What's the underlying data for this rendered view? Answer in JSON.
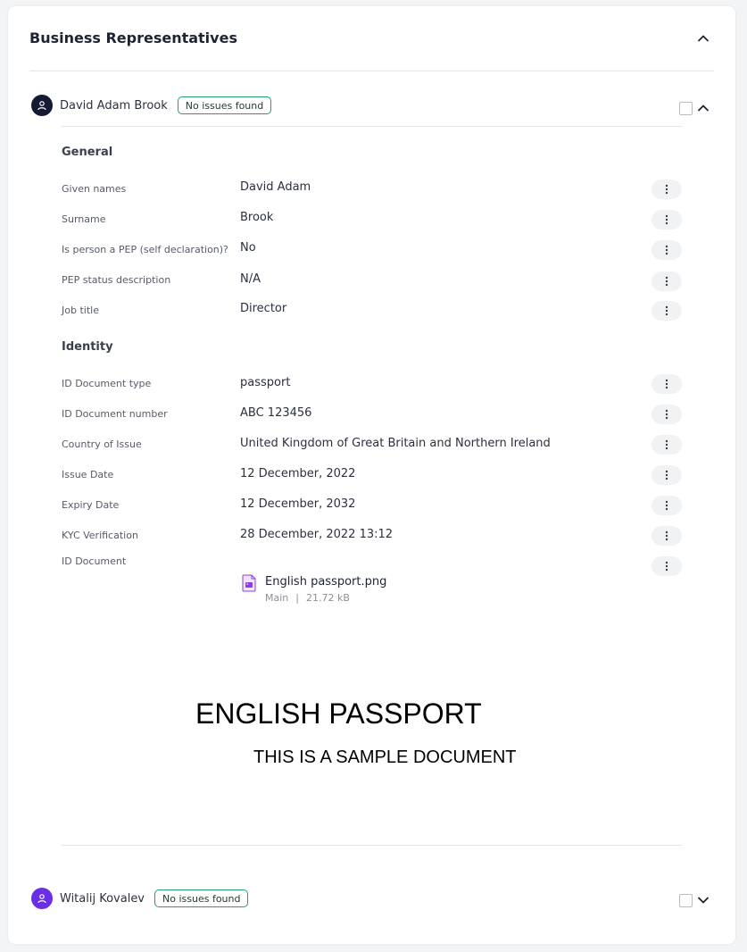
{
  "section": {
    "title": "Business Representatives"
  },
  "representatives": [
    {
      "name": "David Adam Brook",
      "badge": "No issues found",
      "avatar_color": "#141a33",
      "expanded": true
    },
    {
      "name": "Witalij Kovalev",
      "badge": "No issues found",
      "avatar_color": "#6b2ee6",
      "expanded": false
    }
  ],
  "general": {
    "title": "General",
    "fields": [
      {
        "label": "Given names",
        "value": "David Adam"
      },
      {
        "label": "Surname",
        "value": "Brook"
      },
      {
        "label": "Is person a PEP (self declaration)?",
        "value": "No"
      },
      {
        "label": "PEP status description",
        "value": "N/A"
      },
      {
        "label": "Job title",
        "value": "Director"
      }
    ]
  },
  "identity": {
    "title": "Identity",
    "fields": [
      {
        "label": "ID Document type",
        "value": "passport"
      },
      {
        "label": "ID Document number",
        "value": "ABC 123456"
      },
      {
        "label": "Country of Issue",
        "value": "United Kingdom of Great Britain and Northern Ireland"
      },
      {
        "label": "Issue Date",
        "value": "12 December, 2022"
      },
      {
        "label": "Expiry Date",
        "value": "12 December, 2032"
      },
      {
        "label": "KYC Verification",
        "value": "28 December, 2022 13:12"
      }
    ],
    "document_label": "ID Document"
  },
  "file": {
    "name": "English passport.png",
    "tag": "Main",
    "separator": "|",
    "size": "21.72 kB",
    "icon": "image-file-icon",
    "icon_color": "#8b3fe0"
  },
  "preview": {
    "title": "ENGLISH PASSPORT",
    "subtitle": "THIS IS A SAMPLE DOCUMENT"
  },
  "colors": {
    "badge_border": "#22a06b",
    "divider": "#e3e5e9",
    "kebab_bg": "#f1f2f4"
  }
}
